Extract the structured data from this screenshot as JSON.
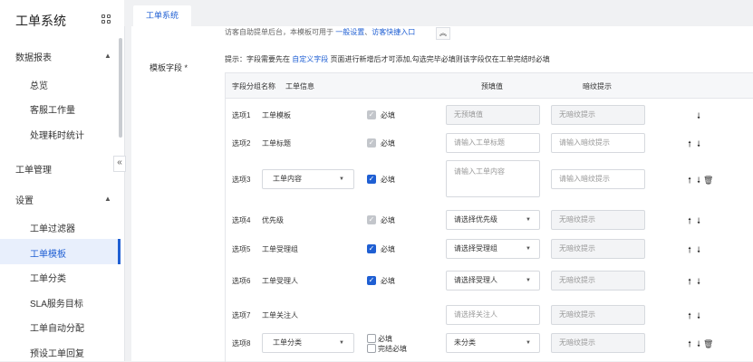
{
  "app": {
    "title": "工单系统"
  },
  "sidebar": {
    "data_reports": {
      "label": "数据报表",
      "items": [
        "总览",
        "客服工作量",
        "处理耗时统计"
      ]
    },
    "ticket_mgmt": {
      "label": "工单管理"
    },
    "settings": {
      "label": "设置",
      "items": [
        "工单过滤器",
        "工单模板",
        "工单分类",
        "SLA服务目标",
        "工单自动分配",
        "预设工单回复"
      ]
    },
    "active_item": "工单模板"
  },
  "tabs": [
    {
      "label": "工单系统"
    }
  ],
  "main": {
    "top_hint": {
      "text": "访客自助提单后台，本模板可用于",
      "link1": "一般设置",
      "sep": "、",
      "link2": "访客快捷入口"
    },
    "field_label": "模板字段 *",
    "tip": {
      "pre": "提示：字段需要先在",
      "link": "自定义字段",
      "post": "页面进行新增后才可添加,勾选完毕必填则该字段仅在工单完结时必填"
    },
    "table": {
      "headers": {
        "group": "字段分组名称",
        "info": "工单信息",
        "default": "预填值",
        "placeholder": "暗纹提示"
      },
      "required_label": "必填",
      "on_close_required_label": "完结必填",
      "rows": [
        {
          "opt": "选项1",
          "field": "工单模板",
          "field_type": "text",
          "check": "grey",
          "default": "无预填值",
          "default_type": "disabled",
          "ph": "无暗纹提示",
          "ph_disabled": true,
          "actions": "down"
        },
        {
          "opt": "选项2",
          "field": "工单标题",
          "field_type": "text",
          "check": "grey",
          "default": "请输入工单标题",
          "default_type": "input",
          "ph": "请输入暗纹提示",
          "ph_disabled": false,
          "actions": "updown"
        },
        {
          "opt": "选项3",
          "field": "工单内容",
          "field_type": "select",
          "check": "blue",
          "default": "请输入工单内容",
          "default_type": "textarea",
          "ph": "请输入暗纹提示",
          "ph_disabled": false,
          "actions": "updowndel"
        },
        {
          "opt": "选项4",
          "field": "优先级",
          "field_type": "text",
          "check": "grey",
          "default": "请选择优先级",
          "default_type": "select",
          "ph": "无暗纹提示",
          "ph_disabled": true,
          "actions": "updown"
        },
        {
          "opt": "选项5",
          "field": "工单受理组",
          "field_type": "text",
          "check": "blue",
          "default": "请选择受理组",
          "default_type": "select",
          "ph": "无暗纹提示",
          "ph_disabled": true,
          "actions": "updown"
        },
        {
          "opt": "选项6",
          "field": "工单受理人",
          "field_type": "text",
          "check": "blue",
          "default": "请选择受理人",
          "default_type": "select",
          "ph": "无暗纹提示",
          "ph_disabled": true,
          "actions": "updown"
        },
        {
          "opt": "选项7",
          "field": "工单关注人",
          "field_type": "text",
          "check": "none",
          "default": "请选择关注人",
          "default_type": "input",
          "ph": "无暗纹提示",
          "ph_disabled": true,
          "actions": "updown"
        },
        {
          "opt": "选项8",
          "field": "工单分类",
          "field_type": "select",
          "check": "double",
          "default": "未分类",
          "default_type": "select",
          "ph": "无暗纹提示",
          "ph_disabled": true,
          "actions": "updowndel"
        }
      ]
    }
  },
  "icons": {
    "up": "arrow-up-icon",
    "down": "arrow-down-icon",
    "delete": "trash-icon",
    "collapse": "chevron-left-icon",
    "grid": "grid-icon"
  }
}
